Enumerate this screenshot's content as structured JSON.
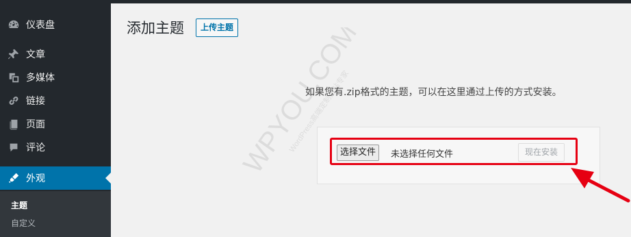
{
  "sidebar": {
    "items": [
      {
        "label": "仪表盘",
        "icon": "dashboard-icon"
      },
      {
        "label": "文章",
        "icon": "pushpin-icon"
      },
      {
        "label": "多媒体",
        "icon": "media-icon"
      },
      {
        "label": "链接",
        "icon": "link-icon"
      },
      {
        "label": "页面",
        "icon": "page-icon"
      },
      {
        "label": "评论",
        "icon": "comment-icon"
      },
      {
        "label": "外观",
        "icon": "appearance-icon"
      }
    ],
    "submenu": [
      "主题",
      "自定义"
    ]
  },
  "main": {
    "title": "添加主题",
    "upload_button": "上传主题",
    "description": "如果您有.zip格式的主题，可以在这里通过上传的方式安装。",
    "file_button": "选择文件",
    "file_status": "未选择任何文件",
    "install_button": "现在安装"
  },
  "watermark": {
    "brand": "WPYOU.COM",
    "subtitle": "WordPress高端定制建站专家"
  },
  "colors": {
    "sidebar_bg": "#23282d",
    "active_bg": "#0073aa",
    "highlight": "#e60012"
  }
}
